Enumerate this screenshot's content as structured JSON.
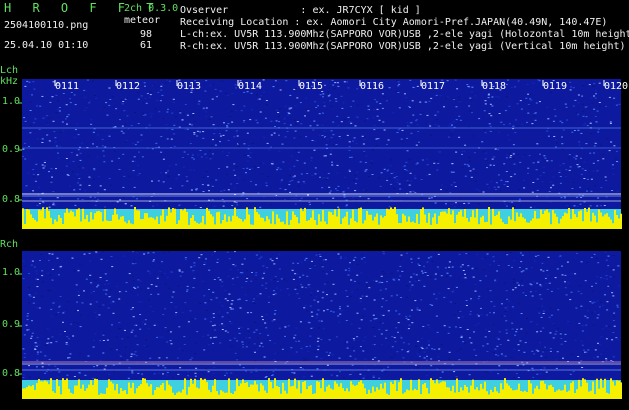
{
  "header": {
    "app_title": "H R O F F T",
    "version": "2ch 0.3.0",
    "meteor_label": "meteor",
    "filename": "2504100110.png",
    "datetime": "25.04.10 01:10",
    "meteor_count_lch": "98",
    "meteor_count_rch": "61",
    "observer_line": "Ovserver            : ex. JR7CYX [ kid ]",
    "location_line": "Receiving Location : ex. Aomori City Aomori-Pref.JAPAN(40.49N, 140.47E)",
    "lch_line": "L-ch:ex. UV5R 113.900Mhz(SAPPORO VOR)USB ,2-ele yagi (Holozontal 10m height)",
    "rch_line": "R-ch:ex. UV5R 113.900Mhz(SAPPORO VOR)USB ,2-ele yagi (Vertical 10m height)"
  },
  "time_ticks": [
    "0111",
    "0112",
    "0113",
    "0114",
    "0115",
    "0116",
    "0117",
    "0118",
    "0119",
    "0120"
  ],
  "lch_panel": {
    "label": "Lch",
    "unit": "kHz",
    "y_ticks": [
      "1.0",
      "0.9",
      "0.8"
    ]
  },
  "rch_panel": {
    "label": "Rch",
    "y_ticks": [
      "1.0",
      "0.9",
      "0.8"
    ]
  },
  "colors": {
    "label_green": "#5fe05f",
    "text_white": "#f0f0f0",
    "noise_blue": "#1a2fb0",
    "level_yellow": "#f5f000",
    "level_cyan": "#3fd0e0"
  }
}
